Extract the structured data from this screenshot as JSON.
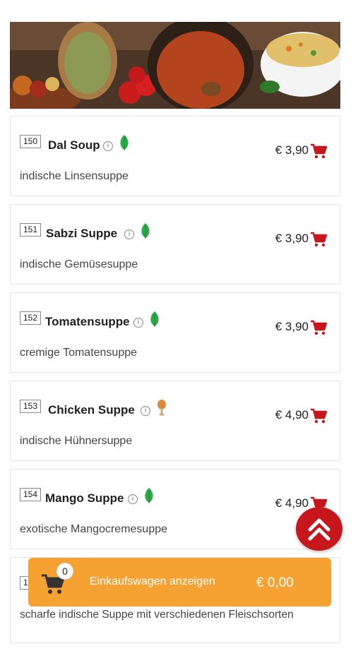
{
  "colors": {
    "accent": "#c8171c",
    "cart_bar": "#f6a232",
    "leaf": "#2eaa4a"
  },
  "items": [
    {
      "number": "150",
      "name": "Dal Soup",
      "price": "€ 3,90",
      "description": "indische Linsensuppe",
      "tag_icon": "leaf-icon"
    },
    {
      "number": "151",
      "name": "Sabzi Suppe",
      "price": "€ 3,90",
      "description": "indische Gemüsesuppe",
      "tag_icon": "leaf-icon"
    },
    {
      "number": "152",
      "name": "Tomatensuppe",
      "price": "€ 3,90",
      "description": "cremige Tomatensuppe",
      "tag_icon": "leaf-icon"
    },
    {
      "number": "153",
      "name": "Chicken Suppe",
      "price": "€ 4,90",
      "description": "indische Hühnersuppe",
      "tag_icon": "chicken-leg-icon"
    },
    {
      "number": "154",
      "name": "Mango Suppe",
      "price": "€ 4,90",
      "description": "exotische Mangocremesuppe",
      "tag_icon": "leaf-icon"
    },
    {
      "number": "1",
      "name": "",
      "price": "",
      "description": "scharfe indische Suppe mit verschiedenen Fleischsorten",
      "tag_icon": ""
    }
  ],
  "cart": {
    "count": "0",
    "label": "Einkaufswagen anzeigen",
    "total": "€ 0,00"
  }
}
